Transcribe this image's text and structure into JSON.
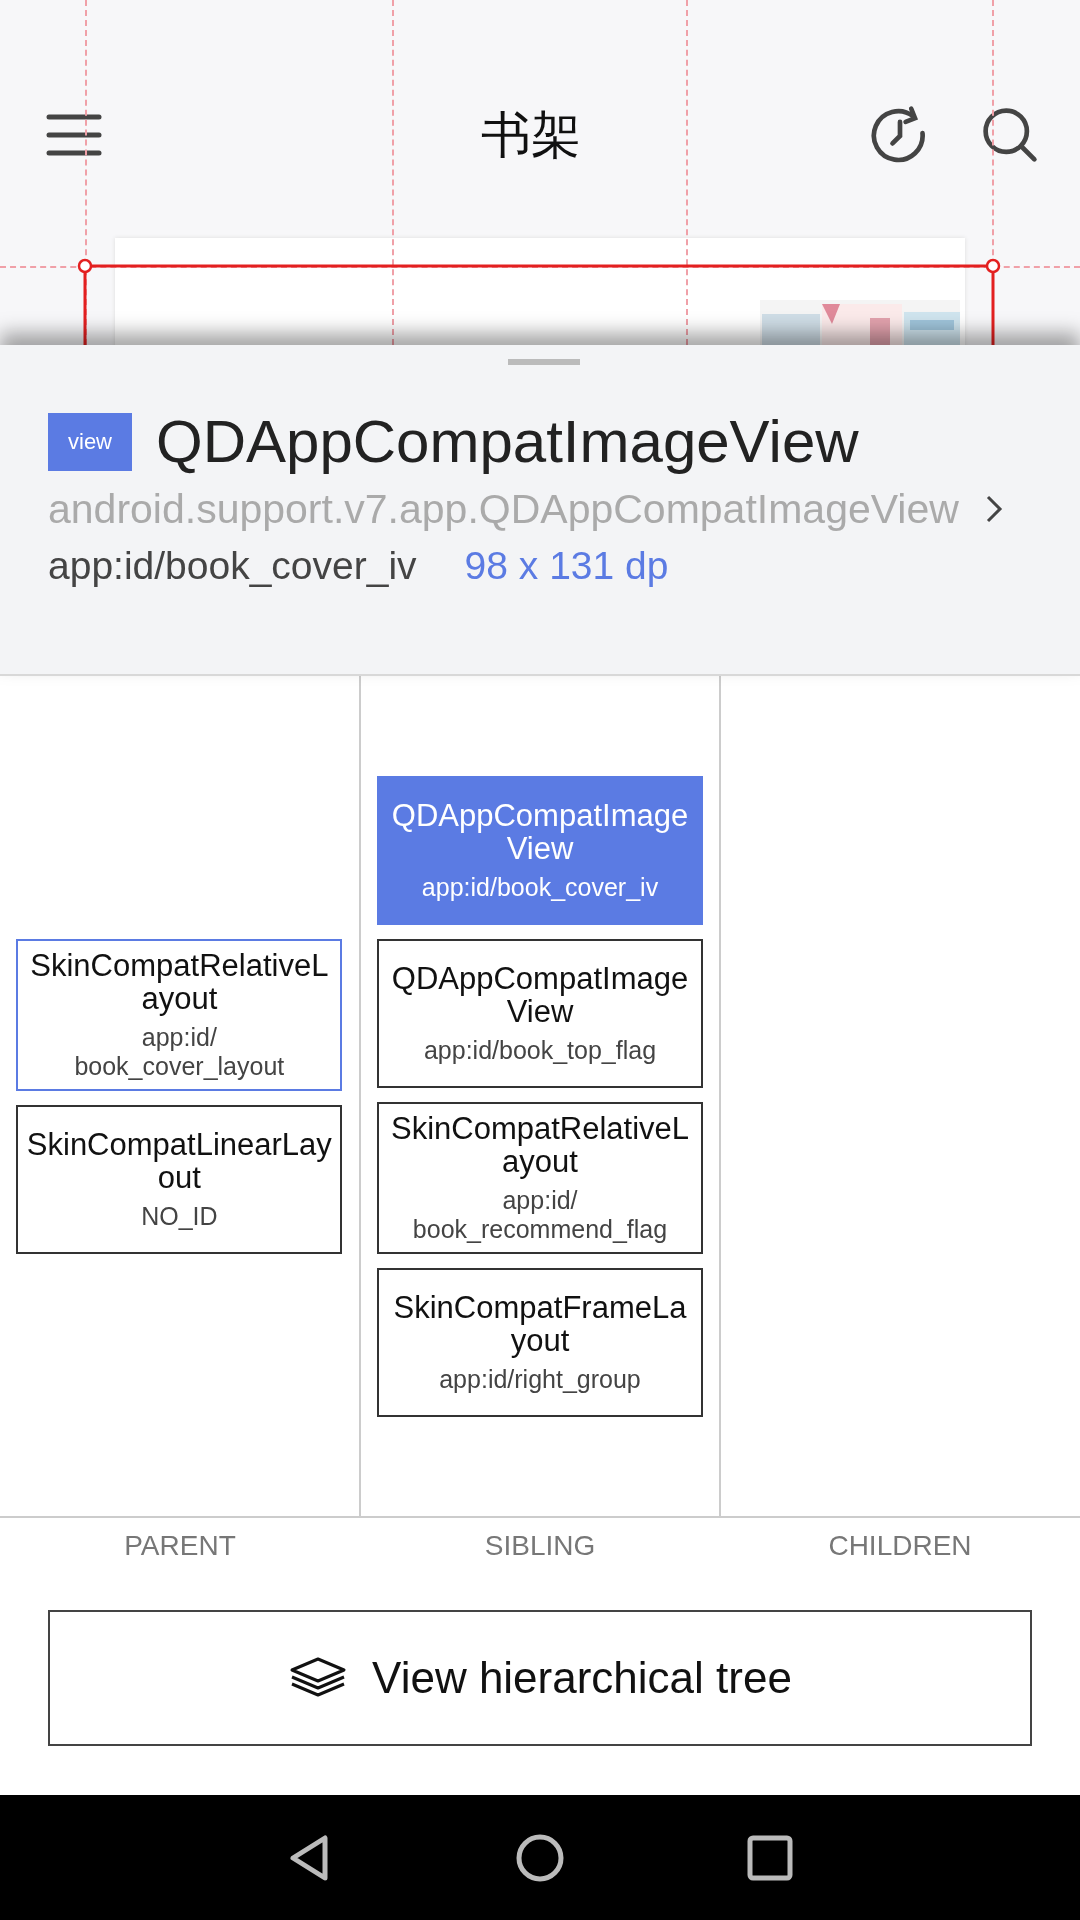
{
  "app_bar": {
    "title": "书架"
  },
  "inspector": {
    "badge": "view",
    "name": "QDAppCompatImageView",
    "class_name": "android.support.v7.app.QDAppCompatImageView",
    "resource_id": "app:id/book_cover_iv",
    "size": "98 x 131 dp"
  },
  "columns": [
    {
      "kind": "parent",
      "label": "PARENT",
      "items": [
        {
          "name": "SkinCompatRelativeLayout",
          "id": "app:id/\nbook_cover_layout",
          "selected": true
        },
        {
          "name": "SkinCompatLinearLayout",
          "id": "NO_ID",
          "selected": false
        }
      ]
    },
    {
      "kind": "sibling",
      "label": "SIBLING",
      "items": [
        {
          "name": "QDAppCompatImageView",
          "id": "app:id/book_cover_iv",
          "selected": true
        },
        {
          "name": "QDAppCompatImageView",
          "id": "app:id/book_top_flag",
          "selected": false
        },
        {
          "name": "SkinCompatRelativeLayout",
          "id": "app:id/\nbook_recommend_flag",
          "selected": false
        },
        {
          "name": "SkinCompatFrameLayout",
          "id": "app:id/right_group",
          "selected": false
        }
      ]
    },
    {
      "kind": "children",
      "label": "CHILDREN"
    }
  ],
  "tree_button": {
    "label": "View hierarchical tree"
  }
}
